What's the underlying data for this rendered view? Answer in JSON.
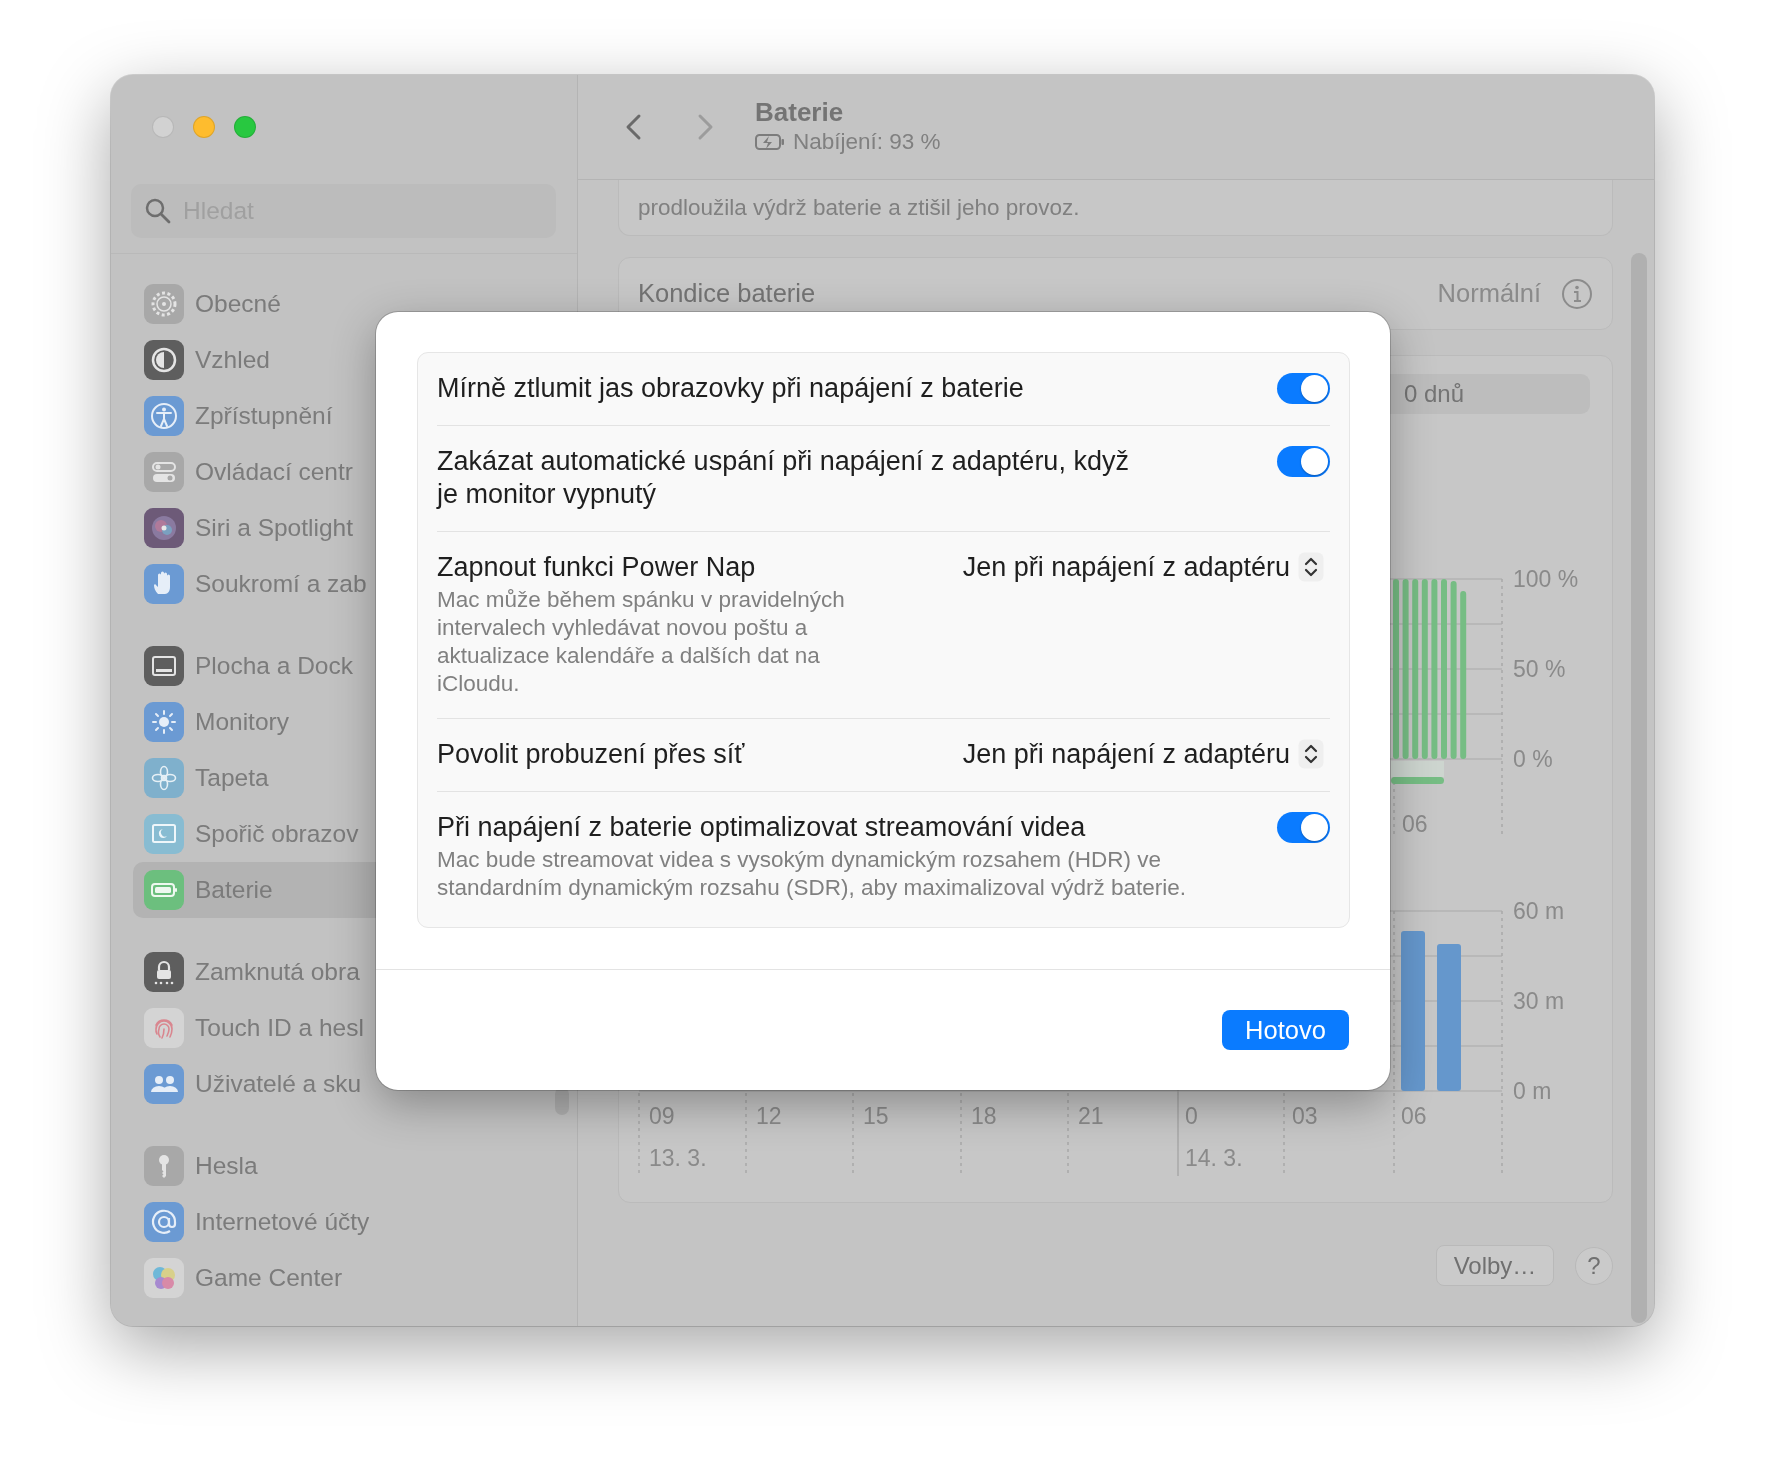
{
  "window": {
    "traffic_lights": [
      {
        "color": "#d2d2d2"
      },
      {
        "color": "#febc2e"
      },
      {
        "color": "#28c840"
      }
    ]
  },
  "sidebar": {
    "search": {
      "placeholder": "Hledat"
    },
    "sections": [
      {
        "items": [
          {
            "label": "Obecné",
            "selected": false
          },
          {
            "label": "Vzhled",
            "selected": false
          },
          {
            "label": "Zpřístupnění",
            "selected": false
          },
          {
            "label": "Ovládací centr",
            "selected": false
          },
          {
            "label": "Siri a Spotlight",
            "selected": false
          },
          {
            "label": "Soukromí a zab",
            "selected": false
          }
        ]
      },
      {
        "items": [
          {
            "label": "Plocha a Dock",
            "selected": false
          },
          {
            "label": "Monitory",
            "selected": false
          },
          {
            "label": "Tapeta",
            "selected": false
          },
          {
            "label": "Spořič obrazov",
            "selected": false
          },
          {
            "label": "Baterie",
            "selected": true
          }
        ]
      },
      {
        "items": [
          {
            "label": "Zamknutá obra",
            "selected": false
          },
          {
            "label": "Touch ID a hesl",
            "selected": false
          },
          {
            "label": "Uživatelé a sku",
            "selected": false
          }
        ]
      },
      {
        "items": [
          {
            "label": "Hesla",
            "selected": false
          },
          {
            "label": "Internetové účty",
            "selected": false
          },
          {
            "label": "Game Center",
            "selected": false
          }
        ]
      }
    ]
  },
  "header": {
    "title": "Baterie",
    "subtitle": "Nabíjení: 93 %"
  },
  "content": {
    "note": "prodloužila výdrž baterie a ztišil jeho provoz.",
    "health": {
      "label": "Kondice baterie",
      "value": "Normální"
    },
    "usage": {
      "range": "0 dnů",
      "level_chart": {
        "y_labels": [
          "100 %",
          "50 %",
          "0 %"
        ],
        "x_labels": [
          "06"
        ]
      },
      "screen_chart": {
        "y_labels": [
          "60 m",
          "30 m",
          "0 m"
        ],
        "x_labels": [
          "09",
          "12",
          "15",
          "18",
          "21",
          "0",
          "03",
          "06"
        ],
        "dates": [
          "13. 3.",
          "14. 3."
        ]
      }
    },
    "buttons": {
      "options": "Volby…",
      "help": "?"
    }
  },
  "dialog": {
    "rows": [
      {
        "kind": "toggle",
        "title": "Mírně ztlumit jas obrazovky při napájení z baterie",
        "on": true
      },
      {
        "kind": "toggle",
        "title": "Zakázat automatické uspání při napájení z adaptéru, když je monitor vypnutý",
        "on": true
      },
      {
        "kind": "popup",
        "title": "Zapnout funkci Power Nap",
        "description": "Mac může během spánku v pravidelných intervalech vyhledávat novou poštu a aktualizace kalendáře a dalších dat na iCloudu.",
        "value": "Jen při napájení z adaptéru"
      },
      {
        "kind": "popup",
        "title": "Povolit probuzení přes síť",
        "value": "Jen při napájení z adaptéru"
      },
      {
        "kind": "toggle",
        "title": "Při napájení z baterie optimalizovat streamování videa",
        "description": "Mac bude streamovat videa s vysokým dynamickým rozsahem (HDR) ve standardním dynamickým rozsahu (SDR), aby maximalizoval výdrž baterie.",
        "on": true
      }
    ],
    "done_button": "Hotovo"
  }
}
